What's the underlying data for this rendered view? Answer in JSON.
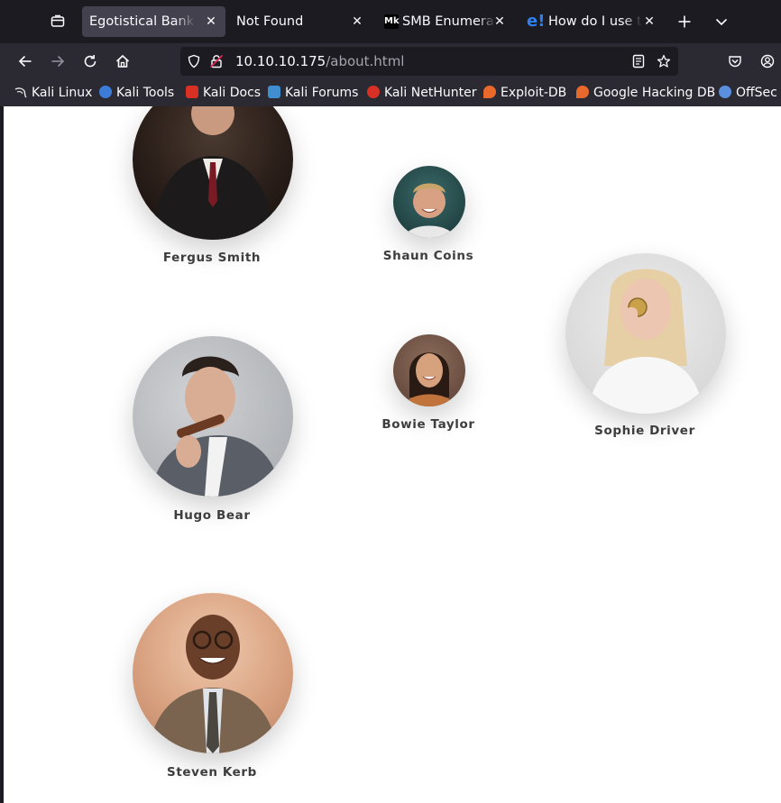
{
  "tabs": [
    {
      "title": "Egotistical Bank :: About",
      "active": true
    },
    {
      "title": "Not Found",
      "active": false
    },
    {
      "title": "SMB Enumeration",
      "active": false,
      "icon_text": "Mk"
    },
    {
      "title": "How do I use tools",
      "active": false,
      "icon_text": "e!"
    }
  ],
  "url": {
    "host": "10.10.10.175",
    "path": "/about.html"
  },
  "bookmarks": [
    {
      "label": "Kali Linux",
      "icon": "kali-dragon-icon",
      "color": "#e8e8e8"
    },
    {
      "label": "Kali Tools",
      "icon": "kali-tools-icon",
      "color": "#3d7bd9"
    },
    {
      "label": "Kali Docs",
      "icon": "kali-docs-icon",
      "color": "#d93025"
    },
    {
      "label": "Kali Forums",
      "icon": "kali-forums-icon",
      "color": "#3e8ed0"
    },
    {
      "label": "Kali NetHunter",
      "icon": "kali-nethunter-icon",
      "color": "#d93025"
    },
    {
      "label": "Exploit-DB",
      "icon": "exploit-db-icon",
      "color": "#e8692b"
    },
    {
      "label": "Google Hacking DB",
      "icon": "ghdb-icon",
      "color": "#e8692b"
    },
    {
      "label": "OffSec",
      "icon": "offsec-icon",
      "color": "#5a8fe0"
    }
  ],
  "team": [
    {
      "name": "Fergus Smith",
      "photo_colors": [
        "#3a2a22",
        "#15110f"
      ]
    },
    {
      "name": "Shaun Coins",
      "photo_colors": [
        "#2f5a5a",
        "#1a3232"
      ]
    },
    {
      "name": "Sophie Driver",
      "photo_colors": [
        "#d8d8d8",
        "#f4f0ea"
      ]
    },
    {
      "name": "Hugo Bear",
      "photo_colors": [
        "#b9bcc0",
        "#5a5e66"
      ]
    },
    {
      "name": "Bowie Taylor",
      "photo_colors": [
        "#7a5a4a",
        "#c08a63"
      ]
    },
    {
      "name": "Steven Kerb",
      "photo_colors": [
        "#d9a98a",
        "#6a5a4c"
      ]
    }
  ]
}
